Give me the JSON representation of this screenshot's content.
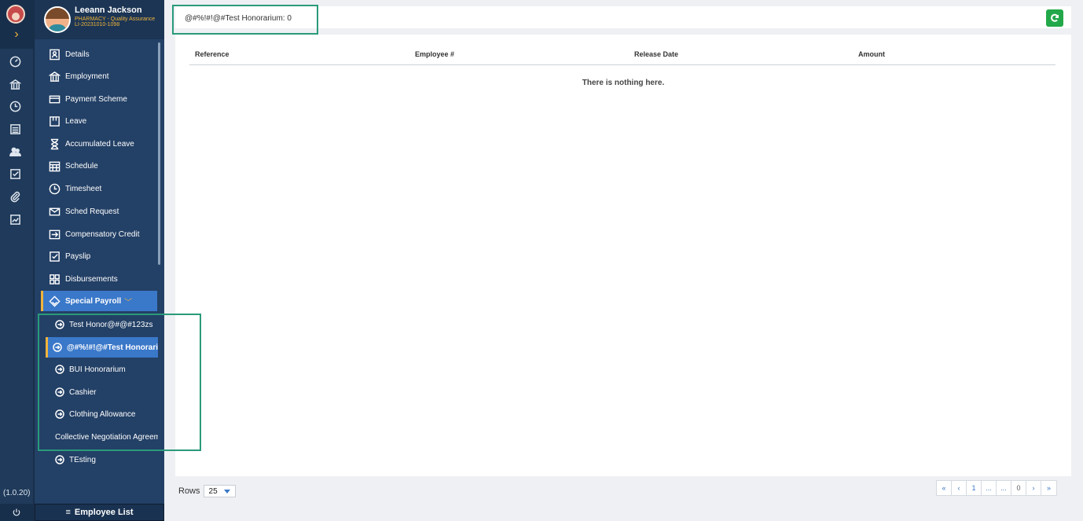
{
  "version": "(1.0.20)",
  "profile": {
    "name": "Leeann Jackson",
    "role": "PHARMACY - Quality Assurance",
    "id": "LI-20231010-1098"
  },
  "menu": [
    {
      "label": "Details",
      "icon": "details-icon"
    },
    {
      "label": "Employment",
      "icon": "bank-icon"
    },
    {
      "label": "Payment Scheme",
      "icon": "card-icon"
    },
    {
      "label": "Leave",
      "icon": "leave-icon"
    },
    {
      "label": "Accumulated Leave",
      "icon": "hourglass-icon"
    },
    {
      "label": "Schedule",
      "icon": "calendar-icon"
    },
    {
      "label": "Timesheet",
      "icon": "clock-icon"
    },
    {
      "label": "Sched Request",
      "icon": "mail-icon"
    },
    {
      "label": "Compensatory Credit",
      "icon": "exchange-icon"
    },
    {
      "label": "Payslip",
      "icon": "checkbox-icon"
    },
    {
      "label": "Disbursements",
      "icon": "grid-icon"
    }
  ],
  "special_payroll": {
    "label": "Special Payroll",
    "items": [
      "Test Honor@#@#123zs",
      "@#%!#!@#Test Honorarium",
      "BUI Honorarium",
      "Cashier",
      "Clothing Allowance",
      "Collective Negotiation Agreeme",
      "TEsting"
    ]
  },
  "footer": {
    "employee_list": "Employee List"
  },
  "main": {
    "title": "@#%!#!@#Test Honorarium: 0",
    "columns": [
      "Reference",
      "Employee #",
      "Release Date",
      "Amount"
    ],
    "empty": "There is nothing here.",
    "rows_label": "Rows",
    "rows_value": "25",
    "pager": [
      "«",
      "‹",
      "1",
      "...",
      "...",
      "0",
      "›",
      "»"
    ]
  },
  "colors": {
    "accent": "#3a78c9",
    "highlight": "#f0b43c",
    "success": "#22a84a"
  }
}
